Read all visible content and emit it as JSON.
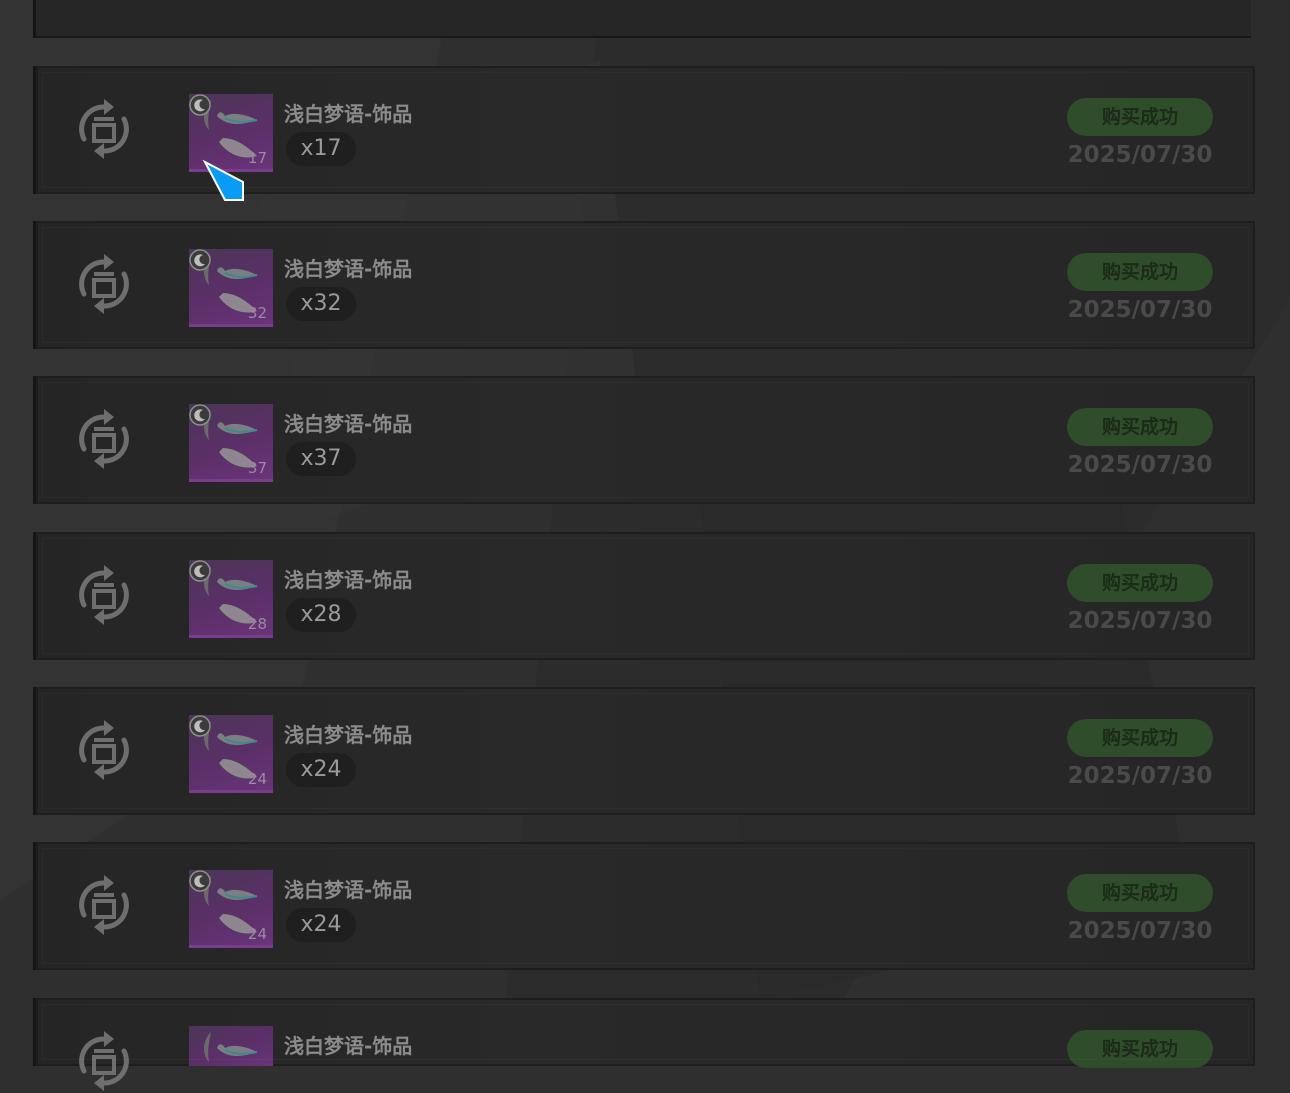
{
  "colors": {
    "background": "#2f2f2f",
    "row_background": "#272727",
    "thumb_purple": "#5b2f68",
    "status_green": "#2f4d2b",
    "status_text": "#1b2b18",
    "date_text": "#4a4a4a",
    "cursor_blue": "#0a9bf5"
  },
  "icons": {
    "row_type_icon": "refresh-cycle-icon",
    "thumb_badge_icon": "moon-badge-icon",
    "cursor": "pointer-cursor-icon"
  },
  "records": [
    {
      "name": "浅白梦语-饰品",
      "thumb_count": "17",
      "qty": "x17",
      "status": "购买成功",
      "date": "2025/07/30"
    },
    {
      "name": "浅白梦语-饰品",
      "thumb_count": "32",
      "qty": "x32",
      "status": "购买成功",
      "date": "2025/07/30"
    },
    {
      "name": "浅白梦语-饰品",
      "thumb_count": "37",
      "qty": "x37",
      "status": "购买成功",
      "date": "2025/07/30"
    },
    {
      "name": "浅白梦语-饰品",
      "thumb_count": "28",
      "qty": "x28",
      "status": "购买成功",
      "date": "2025/07/30"
    },
    {
      "name": "浅白梦语-饰品",
      "thumb_count": "24",
      "qty": "x24",
      "status": "购买成功",
      "date": "2025/07/30"
    },
    {
      "name": "浅白梦语-饰品",
      "thumb_count": "24",
      "qty": "x24",
      "status": "购买成功",
      "date": "2025/07/30"
    },
    {
      "name": "浅白梦语-饰品",
      "thumb_count": "",
      "qty": "",
      "status": "购买成功",
      "date": ""
    }
  ]
}
